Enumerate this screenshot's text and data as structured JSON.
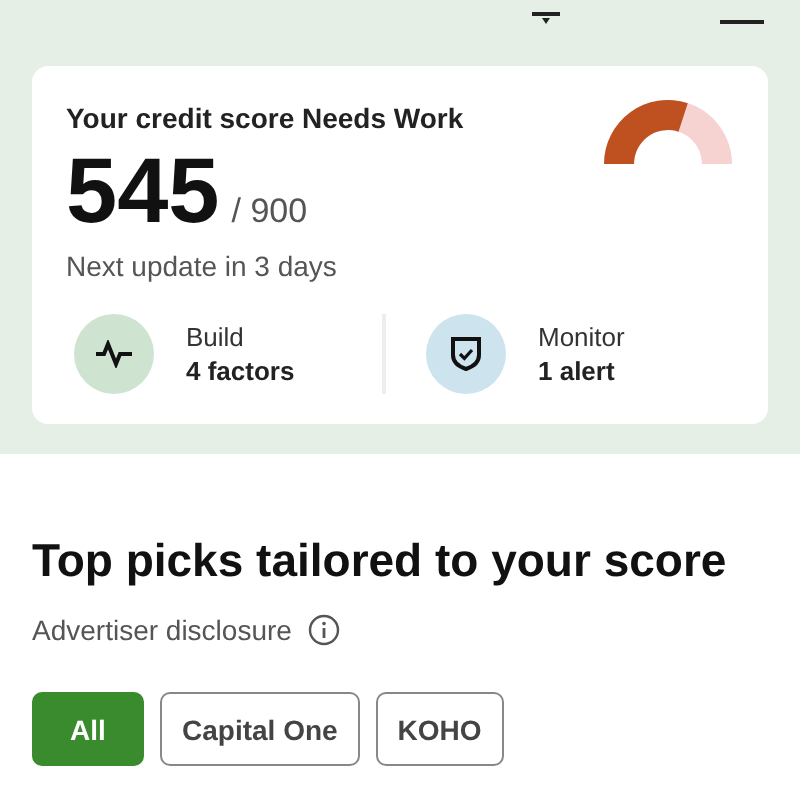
{
  "score_card": {
    "title": "Your credit score Needs Work",
    "score": "545",
    "max": "/ 900",
    "next_update": "Next update in 3 days",
    "actions": [
      {
        "kind": "build",
        "label": "Build",
        "value": "4 factors"
      },
      {
        "kind": "monitor",
        "label": "Monitor",
        "value": "1 alert"
      }
    ]
  },
  "picks": {
    "title": "Top picks tailored to your score",
    "disclosure": "Advertiser disclosure",
    "filters": [
      {
        "label": "All",
        "selected": true
      },
      {
        "label": "Capital One",
        "selected": false
      },
      {
        "label": "KOHO",
        "selected": false
      }
    ]
  }
}
